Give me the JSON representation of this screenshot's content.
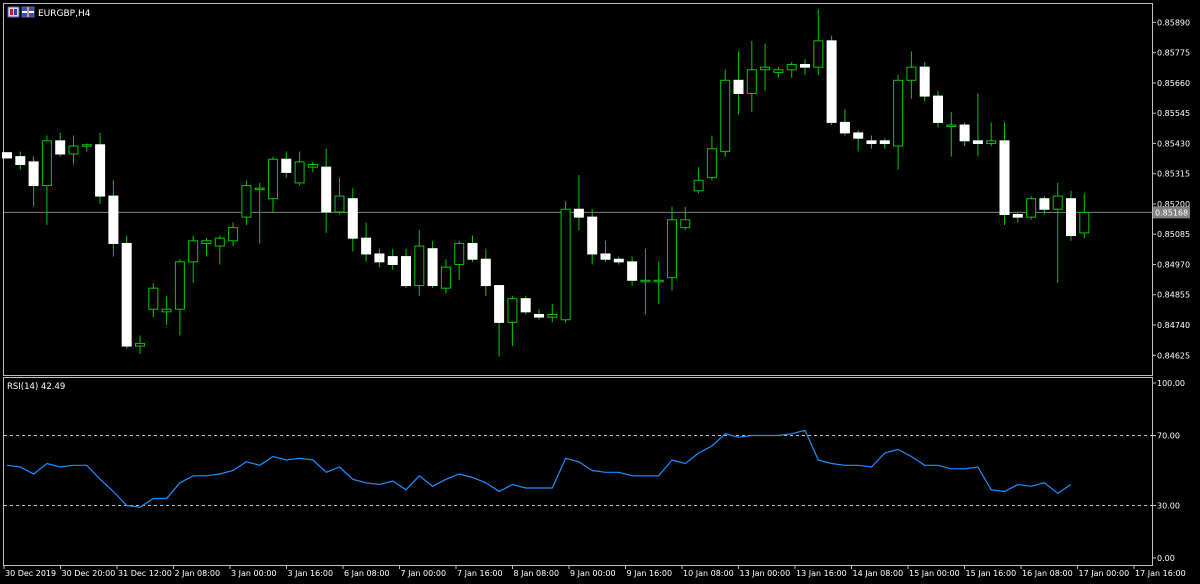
{
  "window": {
    "symbol_label": "EURGBP,H4",
    "icon_names": [
      "chart-window-icon",
      "flag-icon"
    ]
  },
  "colors": {
    "background": "#000000",
    "frame": "#c0c0c0",
    "bull_body": "#000000",
    "bear_body": "#ffffff",
    "wick": "#00c800",
    "price_line": "#808080",
    "rsi_line": "#1e90ff",
    "level_line": "#c0c0c0",
    "price_tag_bg": "#808080"
  },
  "price_axis": {
    "labels": [
      "0.85890",
      "0.85775",
      "0.85660",
      "0.85545",
      "0.85430",
      "0.85315",
      "0.85200",
      "0.85085",
      "0.84970",
      "0.84855",
      "0.84740",
      "0.84625"
    ],
    "current_price": "0.85168"
  },
  "rsi": {
    "label": "RSI(14) 42.49",
    "axis_labels": [
      "100.00",
      "70.00",
      "30.00",
      "0.00"
    ],
    "levels": [
      70,
      30
    ]
  },
  "time_axis": {
    "labels": [
      "30 Dec 2019",
      "30 Dec 20:00",
      "31 Dec 12:00",
      "2 Jan 08:00",
      "3 Jan 00:00",
      "3 Jan 16:00",
      "6 Jan 08:00",
      "7 Jan 00:00",
      "7 Jan 16:00",
      "8 Jan 08:00",
      "9 Jan 00:00",
      "9 Jan 16:00",
      "10 Jan 08:00",
      "13 Jan 00:00",
      "13 Jan 16:00",
      "14 Jan 08:00",
      "15 Jan 00:00",
      "15 Jan 16:00",
      "16 Jan 08:00",
      "17 Jan 00:00",
      "17 Jan 16:00"
    ]
  },
  "chart_data": [
    {
      "type": "candlestick",
      "title": "EURGBP,H4",
      "ylim": [
        0.8455,
        0.8596
      ],
      "current_price": 0.85168,
      "candles": [
        {
          "o": 0.85395,
          "h": 0.85395,
          "l": 0.85375,
          "c": 0.85375
        },
        {
          "o": 0.8538,
          "h": 0.854,
          "l": 0.8533,
          "c": 0.8535
        },
        {
          "o": 0.8536,
          "h": 0.8538,
          "l": 0.8519,
          "c": 0.8527
        },
        {
          "o": 0.8527,
          "h": 0.8546,
          "l": 0.8512,
          "c": 0.8544
        },
        {
          "o": 0.8544,
          "h": 0.8547,
          "l": 0.8538,
          "c": 0.8539
        },
        {
          "o": 0.8539,
          "h": 0.8546,
          "l": 0.8535,
          "c": 0.8542
        },
        {
          "o": 0.8542,
          "h": 0.8543,
          "l": 0.854,
          "c": 0.85425
        },
        {
          "o": 0.85425,
          "h": 0.8547,
          "l": 0.852,
          "c": 0.8523
        },
        {
          "o": 0.8523,
          "h": 0.8529,
          "l": 0.85,
          "c": 0.8505
        },
        {
          "o": 0.8505,
          "h": 0.8508,
          "l": 0.8465,
          "c": 0.8466
        },
        {
          "o": 0.8466,
          "h": 0.847,
          "l": 0.8463,
          "c": 0.8467
        },
        {
          "o": 0.848,
          "h": 0.849,
          "l": 0.8477,
          "c": 0.8488
        },
        {
          "o": 0.8479,
          "h": 0.8485,
          "l": 0.8474,
          "c": 0.848
        },
        {
          "o": 0.848,
          "h": 0.8499,
          "l": 0.847,
          "c": 0.8498
        },
        {
          "o": 0.8498,
          "h": 0.8508,
          "l": 0.849,
          "c": 0.8506
        },
        {
          "o": 0.8505,
          "h": 0.8507,
          "l": 0.85,
          "c": 0.8506
        },
        {
          "o": 0.8504,
          "h": 0.8508,
          "l": 0.8497,
          "c": 0.8507
        },
        {
          "o": 0.8506,
          "h": 0.8513,
          "l": 0.8504,
          "c": 0.8511
        },
        {
          "o": 0.8515,
          "h": 0.8529,
          "l": 0.8512,
          "c": 0.8527
        },
        {
          "o": 0.8526,
          "h": 0.8528,
          "l": 0.8505,
          "c": 0.8526
        },
        {
          "o": 0.8522,
          "h": 0.8538,
          "l": 0.8517,
          "c": 0.8537
        },
        {
          "o": 0.8537,
          "h": 0.854,
          "l": 0.853,
          "c": 0.8532
        },
        {
          "o": 0.8528,
          "h": 0.854,
          "l": 0.8527,
          "c": 0.8536
        },
        {
          "o": 0.8534,
          "h": 0.8536,
          "l": 0.8532,
          "c": 0.8535
        },
        {
          "o": 0.8534,
          "h": 0.8541,
          "l": 0.8509,
          "c": 0.8517
        },
        {
          "o": 0.8517,
          "h": 0.853,
          "l": 0.8516,
          "c": 0.8523
        },
        {
          "o": 0.8522,
          "h": 0.8526,
          "l": 0.8502,
          "c": 0.8507
        },
        {
          "o": 0.8507,
          "h": 0.8513,
          "l": 0.8498,
          "c": 0.8501
        },
        {
          "o": 0.8501,
          "h": 0.8503,
          "l": 0.8496,
          "c": 0.8498
        },
        {
          "o": 0.85,
          "h": 0.8503,
          "l": 0.8495,
          "c": 0.8497
        },
        {
          "o": 0.85,
          "h": 0.8503,
          "l": 0.8488,
          "c": 0.8489
        },
        {
          "o": 0.8489,
          "h": 0.851,
          "l": 0.8485,
          "c": 0.8504
        },
        {
          "o": 0.8503,
          "h": 0.8506,
          "l": 0.8488,
          "c": 0.8489
        },
        {
          "o": 0.8488,
          "h": 0.8499,
          "l": 0.8486,
          "c": 0.8496
        },
        {
          "o": 0.8497,
          "h": 0.8506,
          "l": 0.8491,
          "c": 0.8505
        },
        {
          "o": 0.8505,
          "h": 0.8508,
          "l": 0.8498,
          "c": 0.8499
        },
        {
          "o": 0.8499,
          "h": 0.8503,
          "l": 0.8485,
          "c": 0.8489
        },
        {
          "o": 0.8489,
          "h": 0.8489,
          "l": 0.8462,
          "c": 0.8475
        },
        {
          "o": 0.8475,
          "h": 0.8485,
          "l": 0.8466,
          "c": 0.8484
        },
        {
          "o": 0.8484,
          "h": 0.8485,
          "l": 0.8478,
          "c": 0.8479
        },
        {
          "o": 0.8478,
          "h": 0.848,
          "l": 0.8476,
          "c": 0.8477
        },
        {
          "o": 0.8477,
          "h": 0.8482,
          "l": 0.8475,
          "c": 0.8478
        },
        {
          "o": 0.8476,
          "h": 0.8521,
          "l": 0.8475,
          "c": 0.8518
        },
        {
          "o": 0.8518,
          "h": 0.8531,
          "l": 0.851,
          "c": 0.8515
        },
        {
          "o": 0.8515,
          "h": 0.8518,
          "l": 0.8497,
          "c": 0.8501
        },
        {
          "o": 0.8501,
          "h": 0.8506,
          "l": 0.8498,
          "c": 0.8499
        },
        {
          "o": 0.8499,
          "h": 0.85,
          "l": 0.8497,
          "c": 0.8498
        },
        {
          "o": 0.8498,
          "h": 0.85,
          "l": 0.8489,
          "c": 0.8491
        },
        {
          "o": 0.8491,
          "h": 0.8503,
          "l": 0.8478,
          "c": 0.8491
        },
        {
          "o": 0.8491,
          "h": 0.8498,
          "l": 0.8482,
          "c": 0.8491
        },
        {
          "o": 0.8492,
          "h": 0.8519,
          "l": 0.8487,
          "c": 0.8514
        },
        {
          "o": 0.8511,
          "h": 0.8519,
          "l": 0.851,
          "c": 0.8514
        },
        {
          "o": 0.8525,
          "h": 0.8534,
          "l": 0.8524,
          "c": 0.8529
        },
        {
          "o": 0.853,
          "h": 0.8546,
          "l": 0.8529,
          "c": 0.8541
        },
        {
          "o": 0.854,
          "h": 0.8571,
          "l": 0.8538,
          "c": 0.8567
        },
        {
          "o": 0.8567,
          "h": 0.8578,
          "l": 0.8554,
          "c": 0.8562
        },
        {
          "o": 0.8562,
          "h": 0.8582,
          "l": 0.8555,
          "c": 0.8571
        },
        {
          "o": 0.8571,
          "h": 0.8581,
          "l": 0.8563,
          "c": 0.8572
        },
        {
          "o": 0.857,
          "h": 0.8572,
          "l": 0.8568,
          "c": 0.8571
        },
        {
          "o": 0.8571,
          "h": 0.8574,
          "l": 0.8568,
          "c": 0.8573
        },
        {
          "o": 0.8573,
          "h": 0.8575,
          "l": 0.8569,
          "c": 0.8572
        },
        {
          "o": 0.8572,
          "h": 0.8594,
          "l": 0.8569,
          "c": 0.8582
        },
        {
          "o": 0.8582,
          "h": 0.8584,
          "l": 0.855,
          "c": 0.8551
        },
        {
          "o": 0.8551,
          "h": 0.8556,
          "l": 0.8546,
          "c": 0.8547
        },
        {
          "o": 0.8547,
          "h": 0.8548,
          "l": 0.854,
          "c": 0.8545
        },
        {
          "o": 0.8544,
          "h": 0.8546,
          "l": 0.8541,
          "c": 0.8543
        },
        {
          "o": 0.8544,
          "h": 0.8545,
          "l": 0.8541,
          "c": 0.8543
        },
        {
          "o": 0.8542,
          "h": 0.8569,
          "l": 0.8533,
          "c": 0.8567
        },
        {
          "o": 0.8567,
          "h": 0.8578,
          "l": 0.856,
          "c": 0.8572
        },
        {
          "o": 0.8572,
          "h": 0.8574,
          "l": 0.8559,
          "c": 0.8561
        },
        {
          "o": 0.8561,
          "h": 0.8563,
          "l": 0.8549,
          "c": 0.8551
        },
        {
          "o": 0.855,
          "h": 0.8555,
          "l": 0.8538,
          "c": 0.855
        },
        {
          "o": 0.855,
          "h": 0.8551,
          "l": 0.8542,
          "c": 0.8544
        },
        {
          "o": 0.8544,
          "h": 0.8562,
          "l": 0.8538,
          "c": 0.8543
        },
        {
          "o": 0.8543,
          "h": 0.8551,
          "l": 0.8542,
          "c": 0.8544
        },
        {
          "o": 0.8544,
          "h": 0.8551,
          "l": 0.8512,
          "c": 0.8516
        },
        {
          "o": 0.8516,
          "h": 0.8517,
          "l": 0.8513,
          "c": 0.8515
        },
        {
          "o": 0.8515,
          "h": 0.8523,
          "l": 0.8514,
          "c": 0.8522
        },
        {
          "o": 0.8522,
          "h": 0.8523,
          "l": 0.8516,
          "c": 0.8518
        },
        {
          "o": 0.8518,
          "h": 0.8528,
          "l": 0.849,
          "c": 0.8523
        },
        {
          "o": 0.8522,
          "h": 0.8525,
          "l": 0.8506,
          "c": 0.8508
        },
        {
          "o": 0.8509,
          "h": 0.8524,
          "l": 0.8507,
          "c": 0.85168
        }
      ]
    },
    {
      "type": "line",
      "title": "RSI(14) 42.49",
      "ylim": [
        0,
        100
      ],
      "levels": [
        70,
        30
      ],
      "series": [
        {
          "values": [
            53,
            52,
            48,
            54,
            52,
            53,
            53,
            45,
            38,
            30,
            29,
            34,
            34,
            43,
            47,
            47,
            48,
            50,
            55,
            53,
            58,
            56,
            57,
            56,
            49,
            52,
            45,
            43,
            42,
            44,
            39,
            47,
            41,
            45,
            48,
            46,
            43,
            38,
            42,
            40,
            40,
            40,
            57,
            55,
            50,
            49,
            49,
            47,
            47,
            47,
            56,
            54,
            60,
            64,
            71,
            69,
            70,
            70,
            70,
            71,
            73,
            56,
            54,
            53,
            53,
            52,
            60,
            62,
            58,
            53,
            53,
            51,
            51,
            52,
            39,
            38,
            42,
            41,
            43,
            37,
            42
          ]
        }
      ]
    }
  ]
}
